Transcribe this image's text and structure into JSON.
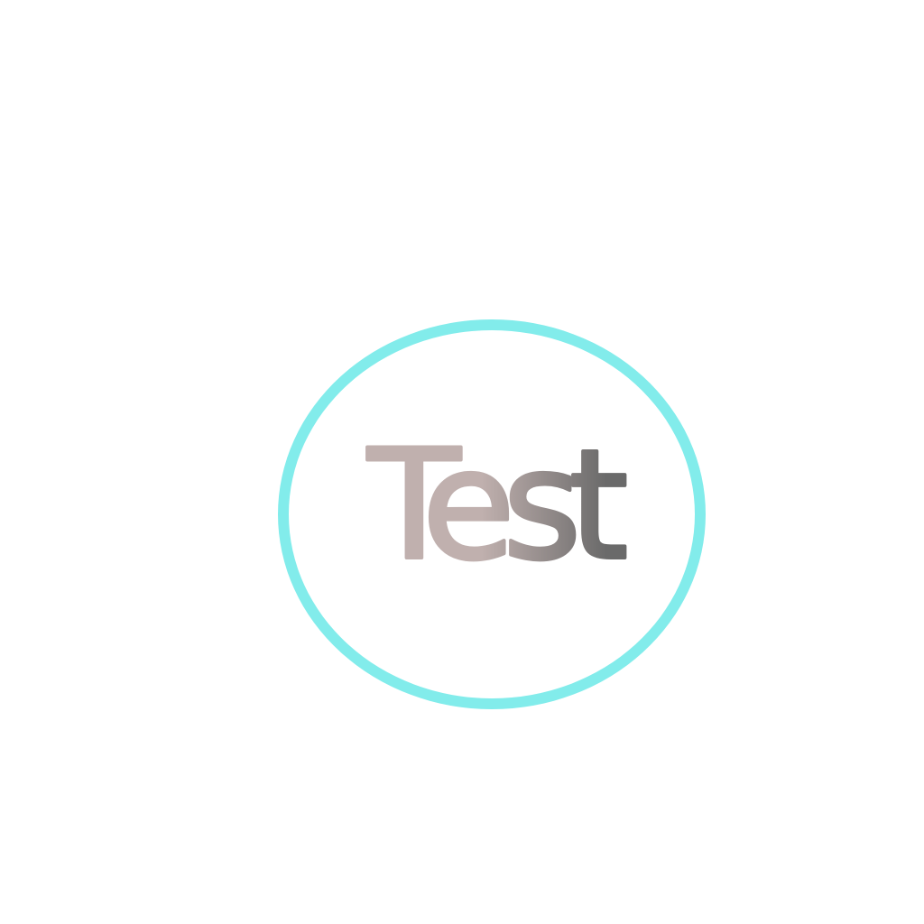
{
  "logo": {
    "text": "Test",
    "ring_color": "#82eceb",
    "gradient_start": "#c0b0ae",
    "gradient_end": "#6a6a6a",
    "background": "#ffffff"
  }
}
